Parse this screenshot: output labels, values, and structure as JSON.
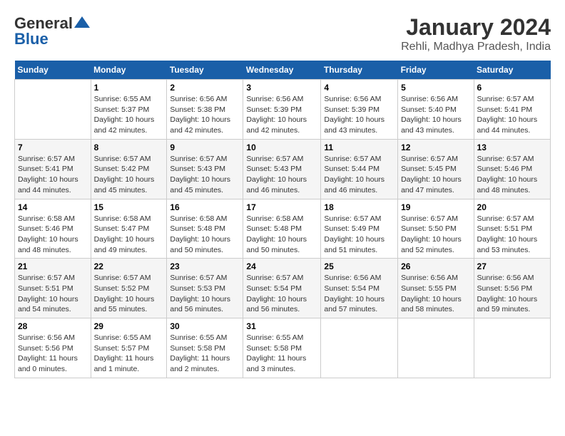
{
  "logo": {
    "line1": "General",
    "line2": "Blue"
  },
  "title": "January 2024",
  "subtitle": "Rehli, Madhya Pradesh, India",
  "headers": [
    "Sunday",
    "Monday",
    "Tuesday",
    "Wednesday",
    "Thursday",
    "Friday",
    "Saturday"
  ],
  "weeks": [
    [
      {
        "day": "",
        "info": ""
      },
      {
        "day": "1",
        "info": "Sunrise: 6:55 AM\nSunset: 5:37 PM\nDaylight: 10 hours\nand 42 minutes."
      },
      {
        "day": "2",
        "info": "Sunrise: 6:56 AM\nSunset: 5:38 PM\nDaylight: 10 hours\nand 42 minutes."
      },
      {
        "day": "3",
        "info": "Sunrise: 6:56 AM\nSunset: 5:39 PM\nDaylight: 10 hours\nand 42 minutes."
      },
      {
        "day": "4",
        "info": "Sunrise: 6:56 AM\nSunset: 5:39 PM\nDaylight: 10 hours\nand 43 minutes."
      },
      {
        "day": "5",
        "info": "Sunrise: 6:56 AM\nSunset: 5:40 PM\nDaylight: 10 hours\nand 43 minutes."
      },
      {
        "day": "6",
        "info": "Sunrise: 6:57 AM\nSunset: 5:41 PM\nDaylight: 10 hours\nand 44 minutes."
      }
    ],
    [
      {
        "day": "7",
        "info": "Sunrise: 6:57 AM\nSunset: 5:41 PM\nDaylight: 10 hours\nand 44 minutes."
      },
      {
        "day": "8",
        "info": "Sunrise: 6:57 AM\nSunset: 5:42 PM\nDaylight: 10 hours\nand 45 minutes."
      },
      {
        "day": "9",
        "info": "Sunrise: 6:57 AM\nSunset: 5:43 PM\nDaylight: 10 hours\nand 45 minutes."
      },
      {
        "day": "10",
        "info": "Sunrise: 6:57 AM\nSunset: 5:43 PM\nDaylight: 10 hours\nand 46 minutes."
      },
      {
        "day": "11",
        "info": "Sunrise: 6:57 AM\nSunset: 5:44 PM\nDaylight: 10 hours\nand 46 minutes."
      },
      {
        "day": "12",
        "info": "Sunrise: 6:57 AM\nSunset: 5:45 PM\nDaylight: 10 hours\nand 47 minutes."
      },
      {
        "day": "13",
        "info": "Sunrise: 6:57 AM\nSunset: 5:46 PM\nDaylight: 10 hours\nand 48 minutes."
      }
    ],
    [
      {
        "day": "14",
        "info": "Sunrise: 6:58 AM\nSunset: 5:46 PM\nDaylight: 10 hours\nand 48 minutes."
      },
      {
        "day": "15",
        "info": "Sunrise: 6:58 AM\nSunset: 5:47 PM\nDaylight: 10 hours\nand 49 minutes."
      },
      {
        "day": "16",
        "info": "Sunrise: 6:58 AM\nSunset: 5:48 PM\nDaylight: 10 hours\nand 50 minutes."
      },
      {
        "day": "17",
        "info": "Sunrise: 6:58 AM\nSunset: 5:48 PM\nDaylight: 10 hours\nand 50 minutes."
      },
      {
        "day": "18",
        "info": "Sunrise: 6:57 AM\nSunset: 5:49 PM\nDaylight: 10 hours\nand 51 minutes."
      },
      {
        "day": "19",
        "info": "Sunrise: 6:57 AM\nSunset: 5:50 PM\nDaylight: 10 hours\nand 52 minutes."
      },
      {
        "day": "20",
        "info": "Sunrise: 6:57 AM\nSunset: 5:51 PM\nDaylight: 10 hours\nand 53 minutes."
      }
    ],
    [
      {
        "day": "21",
        "info": "Sunrise: 6:57 AM\nSunset: 5:51 PM\nDaylight: 10 hours\nand 54 minutes."
      },
      {
        "day": "22",
        "info": "Sunrise: 6:57 AM\nSunset: 5:52 PM\nDaylight: 10 hours\nand 55 minutes."
      },
      {
        "day": "23",
        "info": "Sunrise: 6:57 AM\nSunset: 5:53 PM\nDaylight: 10 hours\nand 56 minutes."
      },
      {
        "day": "24",
        "info": "Sunrise: 6:57 AM\nSunset: 5:54 PM\nDaylight: 10 hours\nand 56 minutes."
      },
      {
        "day": "25",
        "info": "Sunrise: 6:56 AM\nSunset: 5:54 PM\nDaylight: 10 hours\nand 57 minutes."
      },
      {
        "day": "26",
        "info": "Sunrise: 6:56 AM\nSunset: 5:55 PM\nDaylight: 10 hours\nand 58 minutes."
      },
      {
        "day": "27",
        "info": "Sunrise: 6:56 AM\nSunset: 5:56 PM\nDaylight: 10 hours\nand 59 minutes."
      }
    ],
    [
      {
        "day": "28",
        "info": "Sunrise: 6:56 AM\nSunset: 5:56 PM\nDaylight: 11 hours\nand 0 minutes."
      },
      {
        "day": "29",
        "info": "Sunrise: 6:55 AM\nSunset: 5:57 PM\nDaylight: 11 hours\nand 1 minute."
      },
      {
        "day": "30",
        "info": "Sunrise: 6:55 AM\nSunset: 5:58 PM\nDaylight: 11 hours\nand 2 minutes."
      },
      {
        "day": "31",
        "info": "Sunrise: 6:55 AM\nSunset: 5:58 PM\nDaylight: 11 hours\nand 3 minutes."
      },
      {
        "day": "",
        "info": ""
      },
      {
        "day": "",
        "info": ""
      },
      {
        "day": "",
        "info": ""
      }
    ]
  ]
}
